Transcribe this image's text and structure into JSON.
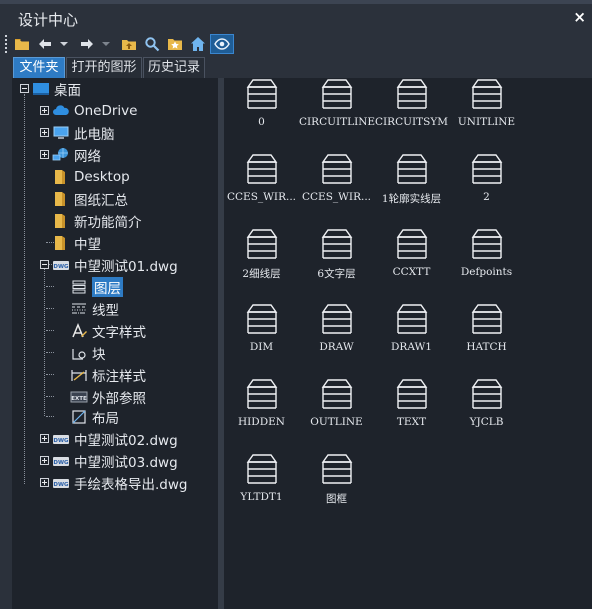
{
  "window": {
    "title": "设计中心",
    "close_label": "×"
  },
  "toolbar": {
    "buttons": [
      {
        "name": "folder-icon"
      },
      {
        "name": "back-arrow-icon"
      },
      {
        "name": "back-dropdown-icon"
      },
      {
        "name": "forward-arrow-icon"
      },
      {
        "name": "forward-dropdown-icon"
      },
      {
        "name": "folder-up-icon"
      },
      {
        "name": "search-icon"
      },
      {
        "name": "favorites-icon"
      },
      {
        "name": "home-icon"
      },
      {
        "name": "eye-icon"
      }
    ]
  },
  "tabs": [
    {
      "label": "文件夹",
      "active": true
    },
    {
      "label": "打开的图形",
      "active": false
    },
    {
      "label": "历史记录",
      "active": false
    }
  ],
  "tree": {
    "desktop": "桌面",
    "onedrive": "OneDrive",
    "this_pc": "此电脑",
    "network": "网络",
    "desktop_folder": "Desktop",
    "drawings": "图纸汇总",
    "new_features": "新功能简介",
    "zwsoft": "中望",
    "dwg01": "中望测试01.dwg",
    "layers": "图层",
    "linetypes": "线型",
    "textstyles": "文字样式",
    "blocks": "块",
    "dimstyles": "标注样式",
    "xrefs": "外部参照",
    "layouts": "布局",
    "dwg02": "中望测试02.dwg",
    "dwg03": "中望测试03.dwg",
    "dwg_export": "手绘表格导出.dwg"
  },
  "layers": [
    "0",
    "CIRCUITLINE",
    "CIRCUITSYM",
    "UNITLINE",
    "CCES_WIR...",
    "CCES_WIR...",
    "1轮廓实线层",
    "2",
    "2细线层",
    "6文字层",
    "CCXTT",
    "Defpoints",
    "DIM",
    "DRAW",
    "DRAW1",
    "HATCH",
    "HIDDEN",
    "OUTLINE",
    "TEXT",
    "YJCLB",
    "YLTDT1",
    "图框"
  ],
  "colors": {
    "selection": "#2e7bc4",
    "background": "#2b313b",
    "panel": "#1e232b"
  }
}
